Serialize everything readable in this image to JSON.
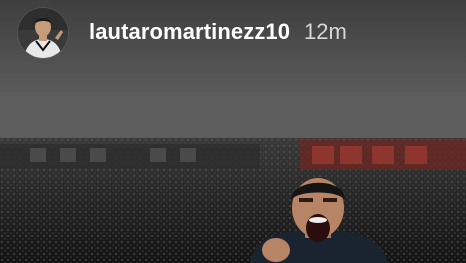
{
  "story": {
    "username": "lautaromartinezz10",
    "timestamp": "12m",
    "avatar_icon": "profile-avatar-icon",
    "photo_icon": "celebrating-player-photo"
  },
  "colors": {
    "header_bg": "#4a4a4a",
    "username": "#ffffff",
    "timestamp": "#d8d8d8",
    "banner_red": "#8a2a22"
  }
}
